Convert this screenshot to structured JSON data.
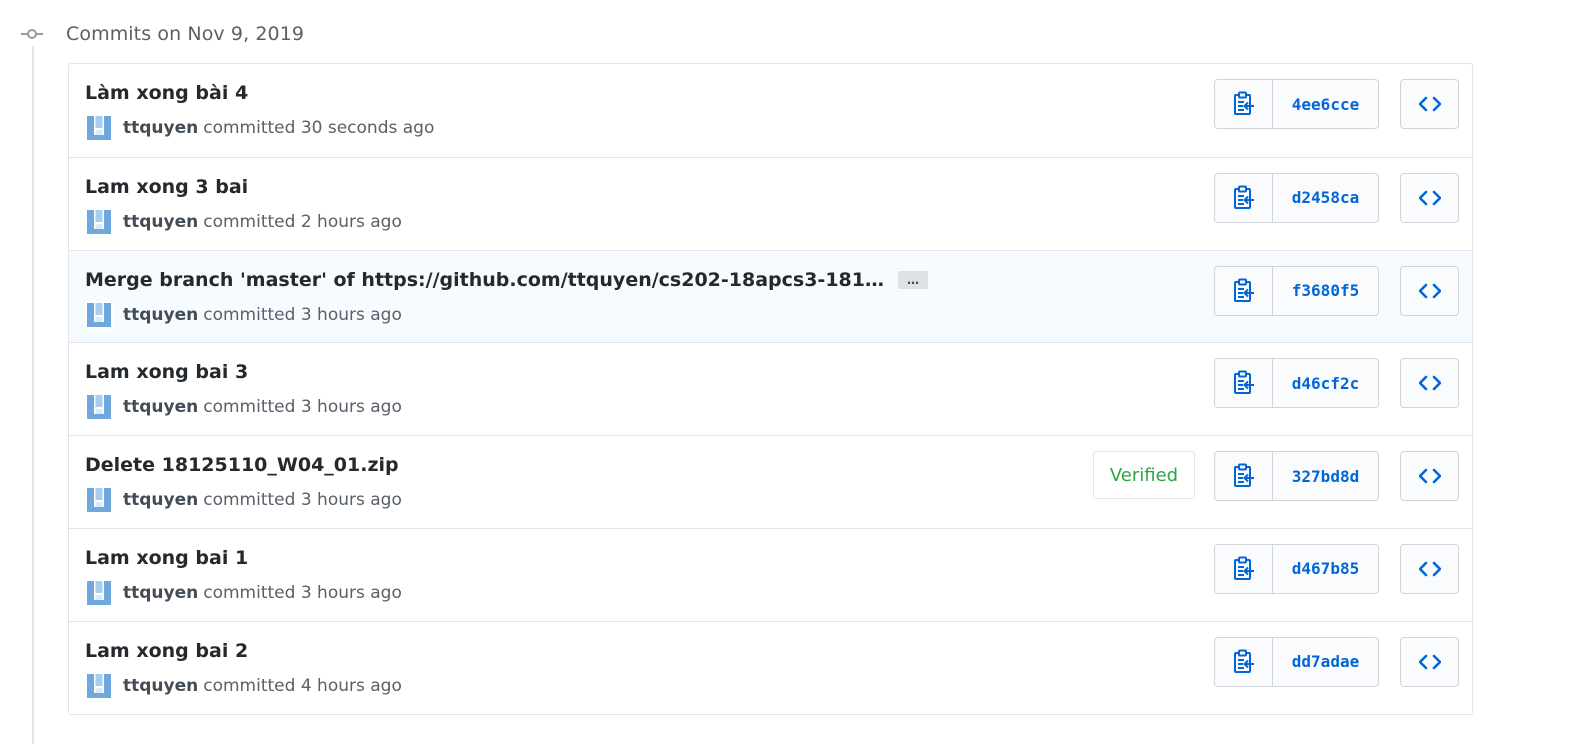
{
  "header": {
    "date_title": "Commits on Nov 9, 2019"
  },
  "colors": {
    "link": "#0366d6",
    "verified": "#28a745",
    "border": "#e1e4e8"
  },
  "commits": [
    {
      "title": "Làm xong bài 4",
      "author": "ttquyen",
      "committed": "committed 30 seconds ago",
      "sha": "4ee6cce"
    },
    {
      "title": "Lam xong 3 bai",
      "author": "ttquyen",
      "committed": "committed 2 hours ago",
      "sha": "d2458ca"
    },
    {
      "title": "Merge branch 'master' of https://github.com/ttquyen/cs202-18apcs3-181…",
      "author": "ttquyen",
      "committed": "committed 3 hours ago",
      "sha": "f3680f5",
      "ellipsis": "…"
    },
    {
      "title": "Lam xong bai 3",
      "author": "ttquyen",
      "committed": "committed 3 hours ago",
      "sha": "d46cf2c"
    },
    {
      "title": "Delete 18125110_W04_01.zip",
      "author": "ttquyen",
      "committed": "committed 3 hours ago",
      "sha": "327bd8d",
      "badge": "Verified"
    },
    {
      "title": "Lam xong bai 1",
      "author": "ttquyen",
      "committed": "committed 3 hours ago",
      "sha": "d467b85"
    },
    {
      "title": "Lam xong bai 2",
      "author": "ttquyen",
      "committed": "committed 4 hours ago",
      "sha": "dd7adae"
    }
  ]
}
